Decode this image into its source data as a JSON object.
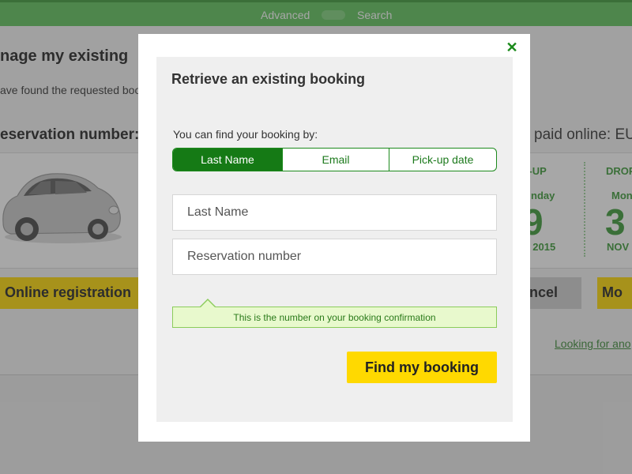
{
  "colors": {
    "brand_green": "#157a15",
    "topbar_green": "#5ec35a",
    "accent_yellow": "#ffd900",
    "hint_background": "#e8f9cd"
  },
  "background_page": {
    "topbar": {
      "advanced_label": "Advanced",
      "search_label": "Search"
    },
    "heading": "nage my existing",
    "subtext": "ave found the requested boo",
    "reservation_label": "eservation number:",
    "paid_online": "paid online:  EU",
    "pickup": {
      "label": "K-UP",
      "day": "nday",
      "date_num": "9",
      "month_year": "V 2015"
    },
    "dropoff": {
      "label": "DROP",
      "day": "Mon",
      "date_num": "3",
      "month_year": "NOV"
    },
    "buttons": {
      "online_registration": "Online registration",
      "cancel": "ncel",
      "more": "Mo"
    },
    "link": "Looking for ano"
  },
  "modal": {
    "title": "Retrieve an existing booking",
    "close_icon": "close-icon",
    "find_by_label": "You can find your booking by:",
    "options": [
      {
        "label": "Last Name",
        "active": true
      },
      {
        "label": "Email",
        "active": false
      },
      {
        "label": "Pick-up date",
        "active": false
      }
    ],
    "last_name": {
      "value": "",
      "placeholder": "Last Name"
    },
    "reservation_number": {
      "value": "",
      "placeholder": "Reservation number"
    },
    "hint": "This is the number on your booking confirmation",
    "submit_label": "Find my booking"
  }
}
